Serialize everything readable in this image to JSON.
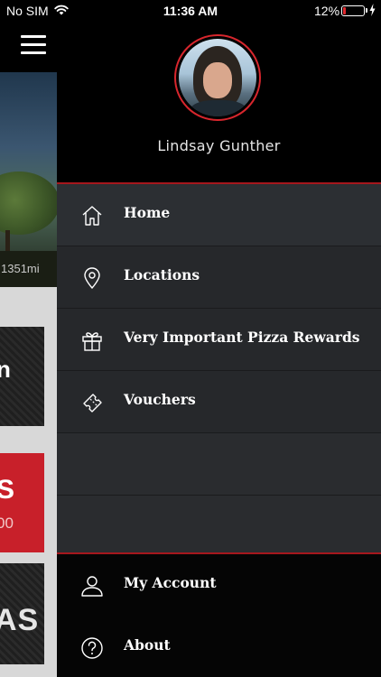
{
  "status_bar": {
    "carrier": "No SIM",
    "time": "11:36 AM",
    "battery_percent": "12%",
    "icons": [
      "wifi-icon",
      "battery-icon",
      "charging-bolt-icon"
    ]
  },
  "background_screen": {
    "distance": "1351mi",
    "tiles": [
      {
        "text": "n"
      },
      {
        "text": "S",
        "sub": "00"
      },
      {
        "text": "AS"
      }
    ]
  },
  "drawer": {
    "user_name": "Lindsay Gunther",
    "accent_color": "#d7262d",
    "menu": [
      {
        "label": "Home",
        "icon": "home-icon"
      },
      {
        "label": "Locations",
        "icon": "location-pin-icon"
      },
      {
        "label": "Very Important Pizza Rewards",
        "icon": "gift-icon"
      },
      {
        "label": "Vouchers",
        "icon": "ticket-icon"
      }
    ],
    "footer_menu": [
      {
        "label": "My Account",
        "icon": "user-icon"
      },
      {
        "label": "About",
        "icon": "help-circle-icon"
      }
    ]
  }
}
